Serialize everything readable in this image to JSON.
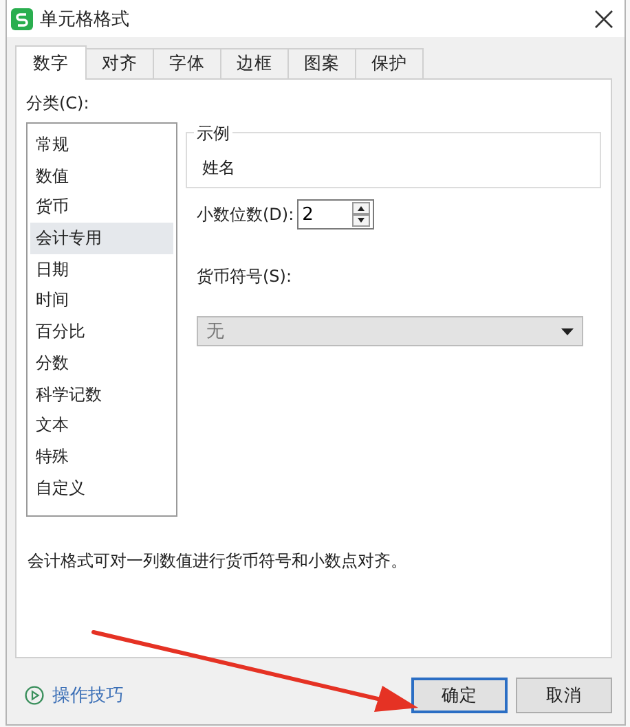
{
  "window": {
    "title": "单元格格式"
  },
  "tabs": [
    {
      "label": "数字",
      "selected": true
    },
    {
      "label": "对齐",
      "selected": false
    },
    {
      "label": "字体",
      "selected": false
    },
    {
      "label": "边框",
      "selected": false
    },
    {
      "label": "图案",
      "selected": false
    },
    {
      "label": "保护",
      "selected": false
    }
  ],
  "category": {
    "label": "分类(C):",
    "items": [
      {
        "label": "常规",
        "selected": false
      },
      {
        "label": "数值",
        "selected": false
      },
      {
        "label": "货币",
        "selected": false
      },
      {
        "label": "会计专用",
        "selected": true
      },
      {
        "label": "日期",
        "selected": false
      },
      {
        "label": "时间",
        "selected": false
      },
      {
        "label": "百分比",
        "selected": false
      },
      {
        "label": "分数",
        "selected": false
      },
      {
        "label": "科学记数",
        "selected": false
      },
      {
        "label": "文本",
        "selected": false
      },
      {
        "label": "特殊",
        "selected": false
      },
      {
        "label": "自定义",
        "selected": false
      }
    ]
  },
  "sample": {
    "label": "示例",
    "value": "姓名"
  },
  "decimal_places": {
    "label": "小数位数(D):",
    "value": "2"
  },
  "currency_symbol": {
    "label": "货币符号(S):",
    "value": "无",
    "disabled": true
  },
  "description": "会计格式可对一列数值进行货币符号和小数点对齐。",
  "tips_link": "操作技巧",
  "buttons": [
    {
      "label": "确定",
      "default": true
    },
    {
      "label": "取消",
      "default": false
    }
  ]
}
